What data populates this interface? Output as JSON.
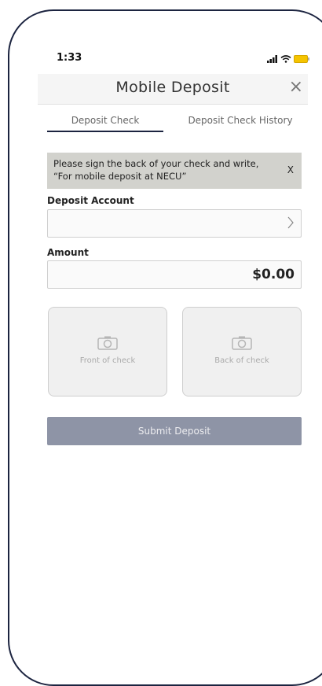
{
  "status_bar": {
    "time": "1:33"
  },
  "header": {
    "title": "Mobile Deposit",
    "close_label": "×"
  },
  "tabs": [
    {
      "label": "Deposit Check",
      "active": true
    },
    {
      "label": "Deposit Check History",
      "active": false
    }
  ],
  "notice": {
    "text": "Please sign the back of your check and write, “For mobile deposit at NECU”",
    "close_label": "X"
  },
  "deposit_account": {
    "label": "Deposit Account",
    "value": ""
  },
  "amount": {
    "label": "Amount",
    "value": "$0.00"
  },
  "photos": {
    "front_label": "Front of check",
    "back_label": "Back of check"
  },
  "submit": {
    "label": "Submit Deposit"
  },
  "colors": {
    "frame": "#1c2440",
    "notice_bg": "#d2d2cd",
    "submit_bg": "#8e94a6",
    "battery": "#f5c400"
  }
}
